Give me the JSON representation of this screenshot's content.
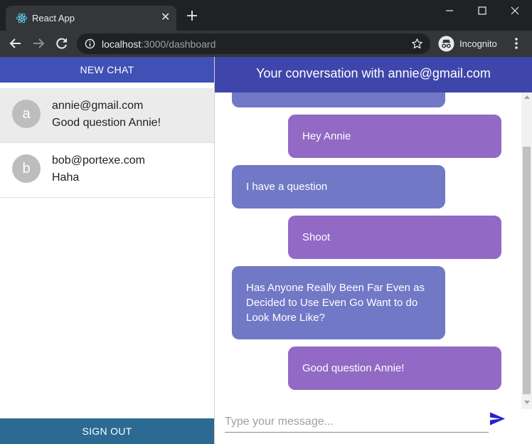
{
  "browser": {
    "tab_title": "React App",
    "url_host": "localhost",
    "url_path": ":3000/dashboard",
    "incognito_label": "Incognito"
  },
  "sidebar": {
    "new_chat_label": "NEW CHAT",
    "sign_out_label": "SIGN OUT",
    "chats": [
      {
        "avatar": "a",
        "email": "annie@gmail.com",
        "preview": "Good question Annie!",
        "selected": true
      },
      {
        "avatar": "b",
        "email": "bob@portexe.com",
        "preview": "Haha",
        "selected": false
      }
    ]
  },
  "conversation": {
    "header": "Your conversation with annie@gmail.com",
    "messages": [
      {
        "from": "them",
        "text": ""
      },
      {
        "from": "me",
        "text": "Hey Annie"
      },
      {
        "from": "them",
        "text": "I have a question"
      },
      {
        "from": "me",
        "text": "Shoot"
      },
      {
        "from": "them",
        "text": "Has Anyone Really Been Far Even as Decided to Use Even Go Want to do Look More Like?"
      },
      {
        "from": "me",
        "text": "Good question Annie!"
      }
    ],
    "input_placeholder": "Type your message...",
    "input_value": ""
  },
  "colors": {
    "new_chat_bg": "#3f51b5",
    "header_bg": "#3f46ab",
    "sign_out_bg": "#2b6b93",
    "bubble_them": "#7178c6",
    "bubble_me": "#9269c4",
    "send_icon": "#2b1fd1"
  },
  "icons": {
    "favicon": "react-logo-icon",
    "send": "send-icon"
  }
}
